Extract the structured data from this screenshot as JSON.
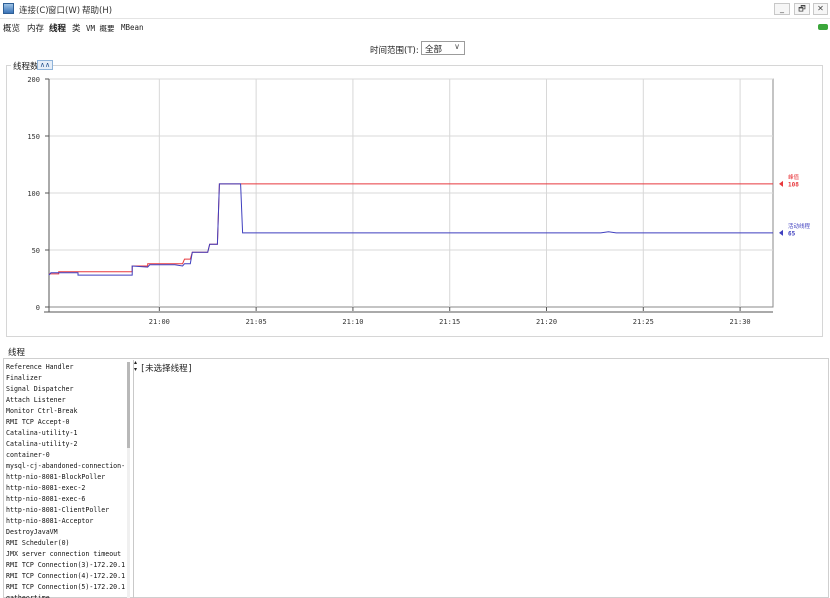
{
  "menubar": {
    "items": [
      "连接(C)",
      "窗口(W)",
      "帮助(H)"
    ],
    "window_buttons": [
      "_",
      "🗗",
      "✕"
    ]
  },
  "tabs": [
    "概览",
    "内存",
    "线程",
    "类",
    "VM 概要",
    "MBean"
  ],
  "selected_tab": "线程",
  "time_range": {
    "label": "时间范围(T):",
    "value": "全部"
  },
  "chart_panel": {
    "title": "线程数",
    "collapse_icon": "double-chevron-up-icon"
  },
  "chart_data": {
    "type": "line",
    "y_ticks": [
      0,
      50,
      100,
      150,
      200
    ],
    "ylim": [
      0,
      200
    ],
    "x_tick_labels": [
      "21:00",
      "21:05",
      "21:10",
      "21:15",
      "21:20",
      "21:25",
      "21:30"
    ],
    "x_tick_minutes": [
      0,
      5,
      10,
      15,
      20,
      25,
      30
    ],
    "xlim_minutes": [
      -5.7,
      31.7
    ],
    "grid": true,
    "series": [
      {
        "name": "峰值",
        "color": "#e8383d",
        "current_label": "108",
        "points": [
          [
            -5.7,
            29
          ],
          [
            -5.2,
            29
          ],
          [
            -5.2,
            31
          ],
          [
            -1.4,
            31
          ],
          [
            -1.4,
            36
          ],
          [
            -0.6,
            36
          ],
          [
            -0.6,
            38
          ],
          [
            0.8,
            38
          ],
          [
            1.2,
            38
          ],
          [
            1.3,
            42
          ],
          [
            1.6,
            42
          ],
          [
            1.7,
            48
          ],
          [
            2.5,
            48
          ],
          [
            2.6,
            55
          ],
          [
            3.0,
            55
          ],
          [
            3.1,
            108
          ],
          [
            31.7,
            108
          ]
        ]
      },
      {
        "name": "活动线程",
        "color": "#3f3fbf",
        "current_label": "65",
        "points": [
          [
            -5.7,
            28
          ],
          [
            -5.6,
            30
          ],
          [
            -4.2,
            30
          ],
          [
            -4.2,
            28
          ],
          [
            -1.4,
            28
          ],
          [
            -1.4,
            36
          ],
          [
            -0.6,
            35
          ],
          [
            -0.5,
            37
          ],
          [
            0.8,
            37
          ],
          [
            1.2,
            36
          ],
          [
            1.3,
            38
          ],
          [
            1.6,
            38
          ],
          [
            1.7,
            48
          ],
          [
            2.5,
            48
          ],
          [
            2.6,
            55
          ],
          [
            3.0,
            55
          ],
          [
            3.1,
            108
          ],
          [
            4.2,
            108
          ],
          [
            4.3,
            65
          ],
          [
            22.8,
            65
          ],
          [
            23.2,
            66
          ],
          [
            23.6,
            65
          ],
          [
            31.7,
            65
          ]
        ]
      }
    ]
  },
  "threads_section": {
    "title": "线程",
    "items": [
      "Reference Handler",
      "Finalizer",
      "Signal Dispatcher",
      "Attach Listener",
      "Monitor Ctrl-Break",
      "RMI TCP Accept-0",
      "Catalina-utility-1",
      "Catalina-utility-2",
      "container-0",
      "mysql-cj-abandoned-connection-",
      "http-nio-8081-BlockPoller",
      "http-nio-8081-exec-2",
      "http-nio-8081-exec-6",
      "http-nio-8081-ClientPoller",
      "http-nio-8081-Acceptor",
      "DestroyJavaVM",
      "RMI Scheduler(0)",
      "JMX server connection timeout",
      "RMI TCP Connection(3)-172.20.1",
      "RMI TCP Connection(4)-172.20.1",
      "RMI TCP Connection(5)-172.20.1",
      "gatheortime"
    ],
    "detail_placeholder": "[未选择线程]"
  }
}
